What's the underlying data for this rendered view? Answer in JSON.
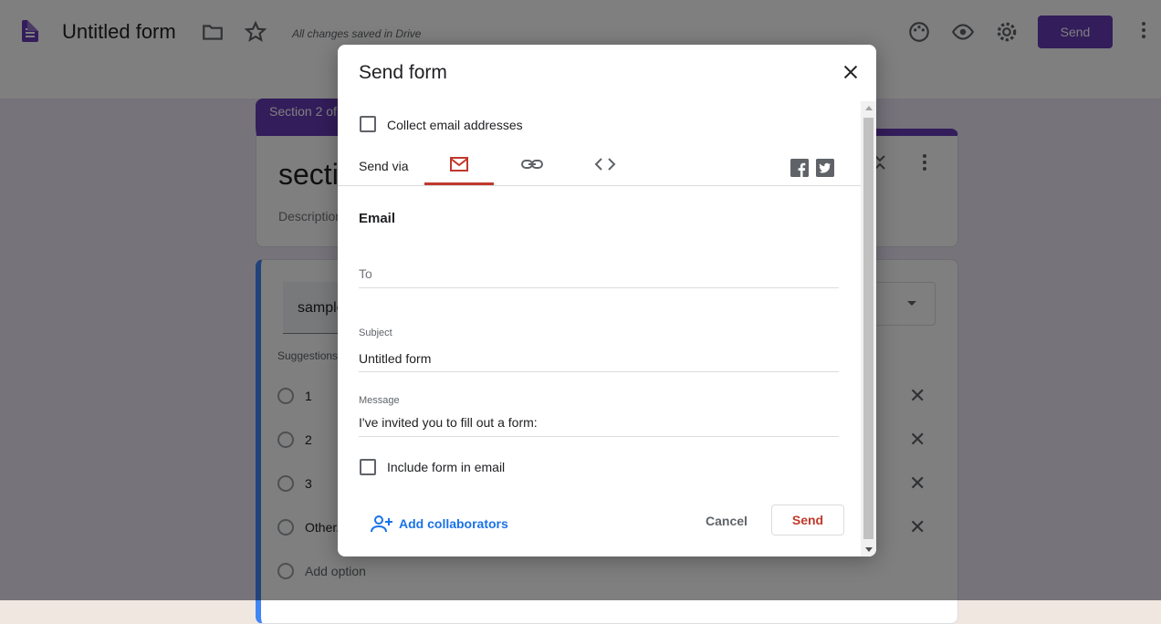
{
  "app": {
    "title": "Untitled form",
    "save_status": "All changes saved in Drive",
    "send_label": "Send"
  },
  "background": {
    "section_tab": "Section 2 of 2",
    "section_title": "section 2",
    "description": "Description (optional)",
    "question": "sample",
    "suggestions": "Suggestions:",
    "options": [
      "1",
      "2",
      "3",
      "Other...",
      "Add option"
    ]
  },
  "dialog": {
    "title": "Send form",
    "collect_email": "Collect email addresses",
    "send_via": "Send via",
    "tabs": [
      "email-icon",
      "link-icon",
      "embed-icon"
    ],
    "section_heading": "Email",
    "to_placeholder": "To",
    "subject_label": "Subject",
    "subject_value": "Untitled form",
    "message_label": "Message",
    "message_value": "I've invited you to fill out a form:",
    "include_form": "Include form in email",
    "add_collaborators": "Add collaborators",
    "cancel": "Cancel",
    "send": "Send"
  },
  "colors": {
    "accent": "#673ab7",
    "dialog_accent": "#c0392b",
    "link": "#1a73e8"
  }
}
